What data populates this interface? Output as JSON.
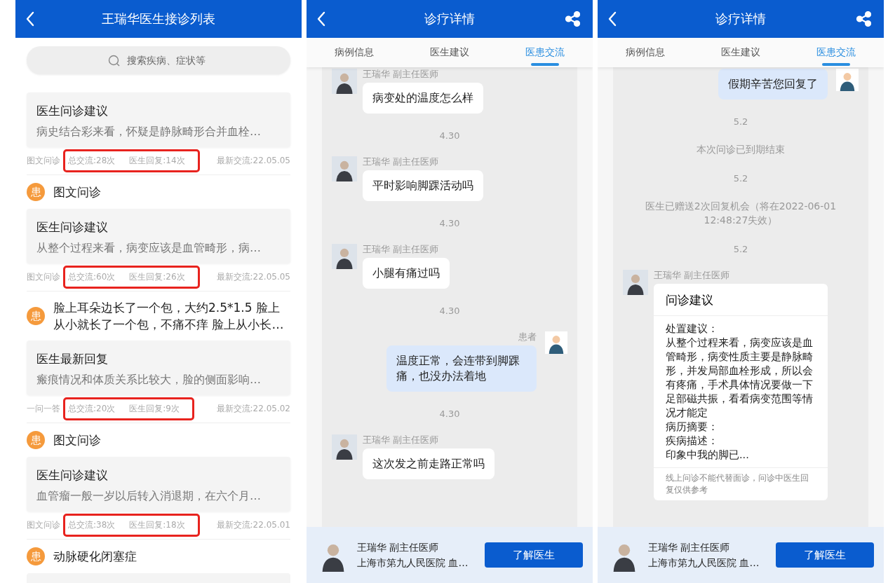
{
  "list_panel": {
    "title": "王瑞华医生接诊列表",
    "search": {
      "placeholder": "搜索疾病、症状等"
    },
    "entries": [
      {
        "kind": "consult",
        "title": "医生问诊建议",
        "excerpt": "病史结合彩来看，怀疑是静脉畸形合并血栓…",
        "type": "图文问诊",
        "total": "总交流:28次",
        "replies": "医生回复:14次",
        "latest": "最新交流:22.05.05",
        "highlighted": true
      },
      {
        "kind": "patient",
        "badge": "患",
        "text": "图文问诊"
      },
      {
        "kind": "consult",
        "title": "医生问诊建议",
        "excerpt": "从整个过程来看，病变应该是血管畸形，病…",
        "type": "图文问诊",
        "total": "总交流:60次",
        "replies": "医生回复:26次",
        "latest": "最新交流:22.05.05",
        "highlighted": true
      },
      {
        "kind": "patient",
        "badge": "患",
        "text": "脸上耳朵边长了一个包，大约2.5*1.5 脸上从小就长了一个包，不痛不痒 脸上从小长…"
      },
      {
        "kind": "consult",
        "title": "医生最新回复",
        "excerpt": "瘢痕情况和体质关系比较大，脸的侧面影响…",
        "type": "一问一答",
        "total": "总交流:20次",
        "replies": "医生回复:9次",
        "latest": "最新交流:22.05.02",
        "highlighted": true
      },
      {
        "kind": "patient",
        "badge": "患",
        "text": "图文问诊"
      },
      {
        "kind": "consult",
        "title": "医生问诊建议",
        "excerpt": "血管瘤一般一岁以后转入消退期，在六个月…",
        "type": "图文问诊",
        "total": "总交流:38次",
        "replies": "医生回复:18次",
        "latest": "最新交流:22.05.01",
        "highlighted": true
      },
      {
        "kind": "patient",
        "badge": "患",
        "text": "动脉硬化闭塞症"
      }
    ]
  },
  "detail_panels": [
    {
      "title": "诊疗详情",
      "tabs": [
        {
          "label": "病例信息",
          "selected": false
        },
        {
          "label": "医生建议",
          "selected": false
        },
        {
          "label": "医患交流",
          "selected": true
        }
      ],
      "messages": [
        {
          "kind": "doctor",
          "name": "王瑞华 副主任医师",
          "text": "病变处的温度怎么样"
        },
        {
          "kind": "time",
          "text": "4.30"
        },
        {
          "kind": "doctor",
          "name": "王瑞华 副主任医师",
          "text": "平时影响脚踝活动吗"
        },
        {
          "kind": "time",
          "text": "4.30"
        },
        {
          "kind": "doctor",
          "name": "王瑞华 副主任医师",
          "text": "小腿有痛过吗"
        },
        {
          "kind": "time",
          "text": "4.30"
        },
        {
          "kind": "patient",
          "name": "患者",
          "text": "温度正常，会连带到脚踝痛，也没办法着地"
        },
        {
          "kind": "time",
          "text": "4.30"
        },
        {
          "kind": "doctor",
          "name": "王瑞华 副主任医师",
          "text": "这次发之前走路正常吗"
        }
      ],
      "doctor_card": {
        "name": "王瑞华 副主任医师",
        "hospital": "上海市第九人民医院 血…",
        "button": "了解医生"
      }
    },
    {
      "title": "诊疗详情",
      "tabs": [
        {
          "label": "病例信息",
          "selected": false
        },
        {
          "label": "医生建议",
          "selected": false
        },
        {
          "label": "医患交流",
          "selected": true
        }
      ],
      "messages": [
        {
          "kind": "patient",
          "text": "假期辛苦您回复了"
        },
        {
          "kind": "time",
          "text": "5.2"
        },
        {
          "kind": "system",
          "text": "本次问诊已到期结束"
        },
        {
          "kind": "time",
          "text": "5.2"
        },
        {
          "kind": "system",
          "text": "医生已赠送2次回复机会（将在2022-06-01 12:48:27失效）"
        },
        {
          "kind": "time",
          "text": "5.2"
        },
        {
          "kind": "advice",
          "name": "王瑞华 副主任医师",
          "title": "问诊建议",
          "body": [
            "处置建议：",
            "从整个过程来看，病变应该是血管畸形，病变性质主要是静脉畸形，并发局部血栓形成，所以会有疼痛，手术具体情况要做一下足部磁共振，看看病变范围等情况才能定",
            "病历摘要：",
            "疾病描述：",
            "印象中我的脚已..."
          ],
          "note": "线上问诊不能代替面诊，问诊中医生回复仅供参考"
        }
      ],
      "doctor_card": {
        "name": "王瑞华 副主任医师",
        "hospital": "上海市第九人民医院 血…",
        "button": "了解医生"
      }
    }
  ]
}
